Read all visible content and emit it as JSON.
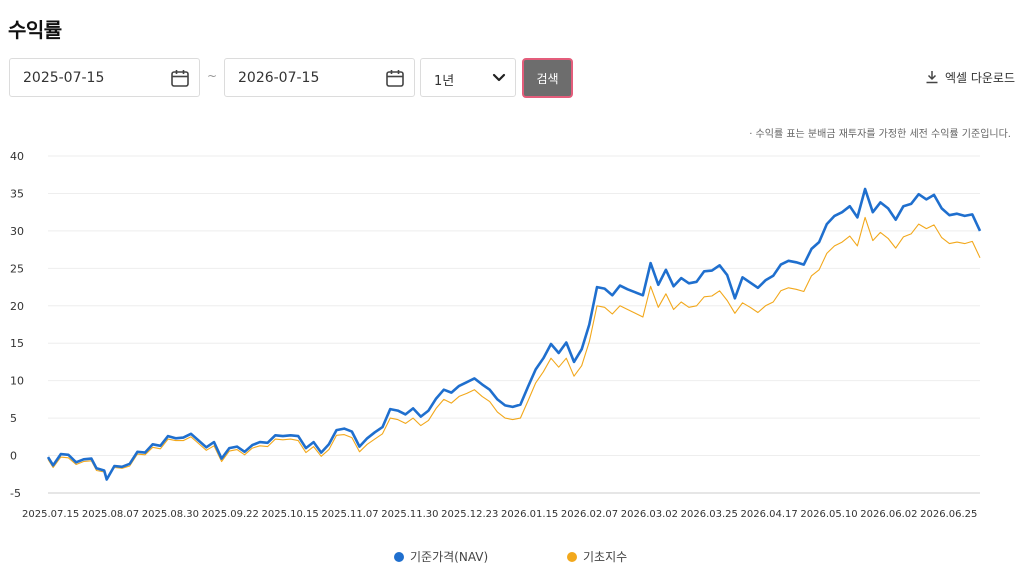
{
  "page": {
    "title": "수익률"
  },
  "filters": {
    "date_from": "2025-07-15",
    "date_to": "2026-07-15",
    "separator": "~",
    "period": "1년",
    "search_label": "검색",
    "excel_label": "엑셀 다운로드"
  },
  "note": "· 수익률 표는 분배금 재투자를 가정한 세전 수익률 기준입니다.",
  "colors": {
    "nav": "#1f6fce",
    "index": "#f2a81c",
    "grid": "#eeeeee",
    "button": "#6d6d6d",
    "button_border": "#e35d7b"
  },
  "chart_data": {
    "type": "line",
    "title": "",
    "xlabel": "",
    "ylabel": "",
    "ylim": [
      -5,
      40
    ],
    "yticks": [
      -5,
      0,
      5,
      10,
      15,
      20,
      25,
      30,
      35,
      40
    ],
    "x_range": [
      "2025-07-15",
      "2026-07-15"
    ],
    "xtick_labels": [
      "2025.07.15",
      "2025.08.07",
      "2025.08.30",
      "2025.09.22",
      "2025.10.15",
      "2025.11.07",
      "2025.11.30",
      "2025.12.23",
      "2026.01.15",
      "2026.02.07",
      "2026.03.02",
      "2026.03.25",
      "2026.04.17",
      "2026.05.10",
      "2026.06.02",
      "2026.06.25"
    ],
    "grid": true,
    "legend": "bottom-center",
    "series": [
      {
        "name": "기준가격(NAV)",
        "color": "#1f6fce",
        "points": [
          [
            "2025-07-15",
            -0.2
          ],
          [
            "2025-07-17",
            -1.3
          ],
          [
            "2025-07-20",
            0.2
          ],
          [
            "2025-07-23",
            0.1
          ],
          [
            "2025-07-26",
            -0.9
          ],
          [
            "2025-07-29",
            -0.5
          ],
          [
            "2025-08-01",
            -0.4
          ],
          [
            "2025-08-03",
            -1.7
          ],
          [
            "2025-08-06",
            -2.0
          ],
          [
            "2025-08-07",
            -3.2
          ],
          [
            "2025-08-10",
            -1.4
          ],
          [
            "2025-08-13",
            -1.5
          ],
          [
            "2025-08-16",
            -1.1
          ],
          [
            "2025-08-19",
            0.5
          ],
          [
            "2025-08-22",
            0.4
          ],
          [
            "2025-08-25",
            1.5
          ],
          [
            "2025-08-28",
            1.3
          ],
          [
            "2025-08-31",
            2.6
          ],
          [
            "2025-09-03",
            2.3
          ],
          [
            "2025-09-06",
            2.4
          ],
          [
            "2025-09-09",
            2.9
          ],
          [
            "2025-09-12",
            2.0
          ],
          [
            "2025-09-15",
            1.1
          ],
          [
            "2025-09-18",
            1.8
          ],
          [
            "2025-09-21",
            -0.4
          ],
          [
            "2025-09-24",
            1.0
          ],
          [
            "2025-09-27",
            1.2
          ],
          [
            "2025-09-30",
            0.5
          ],
          [
            "2025-10-03",
            1.4
          ],
          [
            "2025-10-06",
            1.8
          ],
          [
            "2025-10-09",
            1.7
          ],
          [
            "2025-10-12",
            2.7
          ],
          [
            "2025-10-15",
            2.6
          ],
          [
            "2025-10-18",
            2.7
          ],
          [
            "2025-10-21",
            2.6
          ],
          [
            "2025-10-24",
            1.0
          ],
          [
            "2025-10-27",
            1.8
          ],
          [
            "2025-10-30",
            0.4
          ],
          [
            "2025-11-02",
            1.5
          ],
          [
            "2025-11-05",
            3.4
          ],
          [
            "2025-11-08",
            3.6
          ],
          [
            "2025-11-11",
            3.2
          ],
          [
            "2025-11-14",
            1.2
          ],
          [
            "2025-11-17",
            2.3
          ],
          [
            "2025-11-20",
            3.1
          ],
          [
            "2025-11-23",
            3.8
          ],
          [
            "2025-11-26",
            6.2
          ],
          [
            "2025-11-29",
            6.0
          ],
          [
            "2025-12-02",
            5.5
          ],
          [
            "2025-12-05",
            6.3
          ],
          [
            "2025-12-08",
            5.2
          ],
          [
            "2025-12-11",
            6.0
          ],
          [
            "2025-12-14",
            7.6
          ],
          [
            "2025-12-17",
            8.8
          ],
          [
            "2025-12-20",
            8.4
          ],
          [
            "2025-12-23",
            9.3
          ],
          [
            "2025-12-26",
            9.8
          ],
          [
            "2025-12-29",
            10.3
          ],
          [
            "2026-01-01",
            9.5
          ],
          [
            "2026-01-04",
            8.8
          ],
          [
            "2026-01-07",
            7.5
          ],
          [
            "2026-01-10",
            6.7
          ],
          [
            "2026-01-13",
            6.5
          ],
          [
            "2026-01-16",
            6.8
          ],
          [
            "2026-01-19",
            9.2
          ],
          [
            "2026-01-22",
            11.5
          ],
          [
            "2026-01-25",
            13.0
          ],
          [
            "2026-01-28",
            14.9
          ],
          [
            "2026-01-31",
            13.7
          ],
          [
            "2026-02-03",
            15.1
          ],
          [
            "2026-02-06",
            12.5
          ],
          [
            "2026-02-09",
            14.2
          ],
          [
            "2026-02-12",
            17.5
          ],
          [
            "2026-02-15",
            22.5
          ],
          [
            "2026-02-18",
            22.3
          ],
          [
            "2026-02-21",
            21.4
          ],
          [
            "2026-02-24",
            22.7
          ],
          [
            "2026-02-27",
            22.2
          ],
          [
            "2026-03-02",
            21.8
          ],
          [
            "2026-03-05",
            21.4
          ],
          [
            "2026-03-08",
            25.7
          ],
          [
            "2026-03-11",
            22.8
          ],
          [
            "2026-03-14",
            24.8
          ],
          [
            "2026-03-17",
            22.6
          ],
          [
            "2026-03-20",
            23.7
          ],
          [
            "2026-03-23",
            23.0
          ],
          [
            "2026-03-26",
            23.2
          ],
          [
            "2026-03-29",
            24.6
          ],
          [
            "2026-04-01",
            24.7
          ],
          [
            "2026-04-04",
            25.4
          ],
          [
            "2026-04-07",
            24.1
          ],
          [
            "2026-04-10",
            21.0
          ],
          [
            "2026-04-13",
            23.8
          ],
          [
            "2026-04-16",
            23.1
          ],
          [
            "2026-04-19",
            22.4
          ],
          [
            "2026-04-22",
            23.4
          ],
          [
            "2026-04-25",
            24.0
          ],
          [
            "2026-04-28",
            25.5
          ],
          [
            "2026-05-01",
            26.0
          ],
          [
            "2026-05-04",
            25.8
          ],
          [
            "2026-05-07",
            25.5
          ],
          [
            "2026-05-10",
            27.6
          ],
          [
            "2026-05-13",
            28.5
          ],
          [
            "2026-05-16",
            30.9
          ],
          [
            "2026-05-19",
            32.0
          ],
          [
            "2026-05-22",
            32.5
          ],
          [
            "2026-05-25",
            33.3
          ],
          [
            "2026-05-28",
            31.8
          ],
          [
            "2026-05-31",
            35.6
          ],
          [
            "2026-06-03",
            32.5
          ],
          [
            "2026-06-06",
            33.8
          ],
          [
            "2026-06-09",
            33.0
          ],
          [
            "2026-06-12",
            31.5
          ],
          [
            "2026-06-15",
            33.3
          ],
          [
            "2026-06-18",
            33.6
          ],
          [
            "2026-06-21",
            34.9
          ],
          [
            "2026-06-24",
            34.2
          ],
          [
            "2026-06-27",
            34.8
          ],
          [
            "2026-06-30",
            33.0
          ],
          [
            "2026-07-03",
            32.1
          ],
          [
            "2026-07-06",
            32.3
          ],
          [
            "2026-07-09",
            32.0
          ],
          [
            "2026-07-12",
            32.2
          ],
          [
            "2026-07-15",
            30.0
          ]
        ]
      },
      {
        "name": "기초지수",
        "color": "#f2a81c",
        "points": [
          [
            "2025-07-15",
            -0.5
          ],
          [
            "2025-07-17",
            -1.6
          ],
          [
            "2025-07-20",
            -0.2
          ],
          [
            "2025-07-23",
            -0.3
          ],
          [
            "2025-07-26",
            -1.2
          ],
          [
            "2025-07-29",
            -0.8
          ],
          [
            "2025-08-01",
            -0.7
          ],
          [
            "2025-08-03",
            -2.0
          ],
          [
            "2025-08-06",
            -2.2
          ],
          [
            "2025-08-07",
            -3.0
          ],
          [
            "2025-08-10",
            -1.6
          ],
          [
            "2025-08-13",
            -1.7
          ],
          [
            "2025-08-16",
            -1.4
          ],
          [
            "2025-08-19",
            0.2
          ],
          [
            "2025-08-22",
            0.1
          ],
          [
            "2025-08-25",
            1.1
          ],
          [
            "2025-08-28",
            0.9
          ],
          [
            "2025-08-31",
            2.2
          ],
          [
            "2025-09-03",
            2.0
          ],
          [
            "2025-09-06",
            2.0
          ],
          [
            "2025-09-09",
            2.5
          ],
          [
            "2025-09-12",
            1.6
          ],
          [
            "2025-09-15",
            0.7
          ],
          [
            "2025-09-18",
            1.3
          ],
          [
            "2025-09-21",
            -0.8
          ],
          [
            "2025-09-24",
            0.6
          ],
          [
            "2025-09-27",
            0.8
          ],
          [
            "2025-09-30",
            0.1
          ],
          [
            "2025-10-03",
            1.0
          ],
          [
            "2025-10-06",
            1.3
          ],
          [
            "2025-10-09",
            1.2
          ],
          [
            "2025-10-12",
            2.2
          ],
          [
            "2025-10-15",
            2.1
          ],
          [
            "2025-10-18",
            2.2
          ],
          [
            "2025-10-21",
            2.0
          ],
          [
            "2025-10-24",
            0.4
          ],
          [
            "2025-10-27",
            1.2
          ],
          [
            "2025-10-30",
            -0.1
          ],
          [
            "2025-11-02",
            0.8
          ],
          [
            "2025-11-05",
            2.7
          ],
          [
            "2025-11-08",
            2.8
          ],
          [
            "2025-11-11",
            2.4
          ],
          [
            "2025-11-14",
            0.5
          ],
          [
            "2025-11-17",
            1.5
          ],
          [
            "2025-11-20",
            2.2
          ],
          [
            "2025-11-23",
            2.9
          ],
          [
            "2025-11-26",
            5.0
          ],
          [
            "2025-11-29",
            4.8
          ],
          [
            "2025-12-02",
            4.3
          ],
          [
            "2025-12-05",
            5.0
          ],
          [
            "2025-12-08",
            4.0
          ],
          [
            "2025-12-11",
            4.7
          ],
          [
            "2025-12-14",
            6.3
          ],
          [
            "2025-12-17",
            7.5
          ],
          [
            "2025-12-20",
            7.0
          ],
          [
            "2025-12-23",
            7.9
          ],
          [
            "2025-12-26",
            8.3
          ],
          [
            "2025-12-29",
            8.8
          ],
          [
            "2026-01-01",
            7.9
          ],
          [
            "2026-01-04",
            7.2
          ],
          [
            "2026-01-07",
            5.8
          ],
          [
            "2026-01-10",
            5.0
          ],
          [
            "2026-01-13",
            4.8
          ],
          [
            "2026-01-16",
            5.0
          ],
          [
            "2026-01-19",
            7.3
          ],
          [
            "2026-01-22",
            9.7
          ],
          [
            "2026-01-25",
            11.2
          ],
          [
            "2026-01-28",
            13.0
          ],
          [
            "2026-01-31",
            11.8
          ],
          [
            "2026-02-03",
            13.0
          ],
          [
            "2026-02-06",
            10.6
          ],
          [
            "2026-02-09",
            12.0
          ],
          [
            "2026-02-12",
            15.2
          ],
          [
            "2026-02-15",
            20.0
          ],
          [
            "2026-02-18",
            19.8
          ],
          [
            "2026-02-21",
            18.9
          ],
          [
            "2026-02-24",
            20.0
          ],
          [
            "2026-02-27",
            19.5
          ],
          [
            "2026-03-02",
            19.0
          ],
          [
            "2026-03-05",
            18.5
          ],
          [
            "2026-03-08",
            22.6
          ],
          [
            "2026-03-11",
            19.8
          ],
          [
            "2026-03-14",
            21.6
          ],
          [
            "2026-03-17",
            19.5
          ],
          [
            "2026-03-20",
            20.5
          ],
          [
            "2026-03-23",
            19.8
          ],
          [
            "2026-03-26",
            20.0
          ],
          [
            "2026-03-29",
            21.2
          ],
          [
            "2026-04-01",
            21.3
          ],
          [
            "2026-04-04",
            22.0
          ],
          [
            "2026-04-07",
            20.7
          ],
          [
            "2026-04-10",
            19.0
          ],
          [
            "2026-04-13",
            20.4
          ],
          [
            "2026-04-16",
            19.8
          ],
          [
            "2026-04-19",
            19.1
          ],
          [
            "2026-04-22",
            20.0
          ],
          [
            "2026-04-25",
            20.5
          ],
          [
            "2026-04-28",
            22.0
          ],
          [
            "2026-05-01",
            22.4
          ],
          [
            "2026-05-04",
            22.2
          ],
          [
            "2026-05-07",
            21.9
          ],
          [
            "2026-05-10",
            24.0
          ],
          [
            "2026-05-13",
            24.8
          ],
          [
            "2026-05-16",
            27.0
          ],
          [
            "2026-05-19",
            28.0
          ],
          [
            "2026-05-22",
            28.5
          ],
          [
            "2026-05-25",
            29.3
          ],
          [
            "2026-05-28",
            28.0
          ],
          [
            "2026-05-31",
            31.8
          ],
          [
            "2026-06-03",
            28.7
          ],
          [
            "2026-06-06",
            29.8
          ],
          [
            "2026-06-09",
            29.0
          ],
          [
            "2026-06-12",
            27.7
          ],
          [
            "2026-06-15",
            29.2
          ],
          [
            "2026-06-18",
            29.6
          ],
          [
            "2026-06-21",
            30.9
          ],
          [
            "2026-06-24",
            30.3
          ],
          [
            "2026-06-27",
            30.8
          ],
          [
            "2026-06-30",
            29.1
          ],
          [
            "2026-07-03",
            28.3
          ],
          [
            "2026-07-06",
            28.5
          ],
          [
            "2026-07-09",
            28.3
          ],
          [
            "2026-07-12",
            28.6
          ],
          [
            "2026-07-15",
            26.4
          ]
        ]
      }
    ]
  }
}
